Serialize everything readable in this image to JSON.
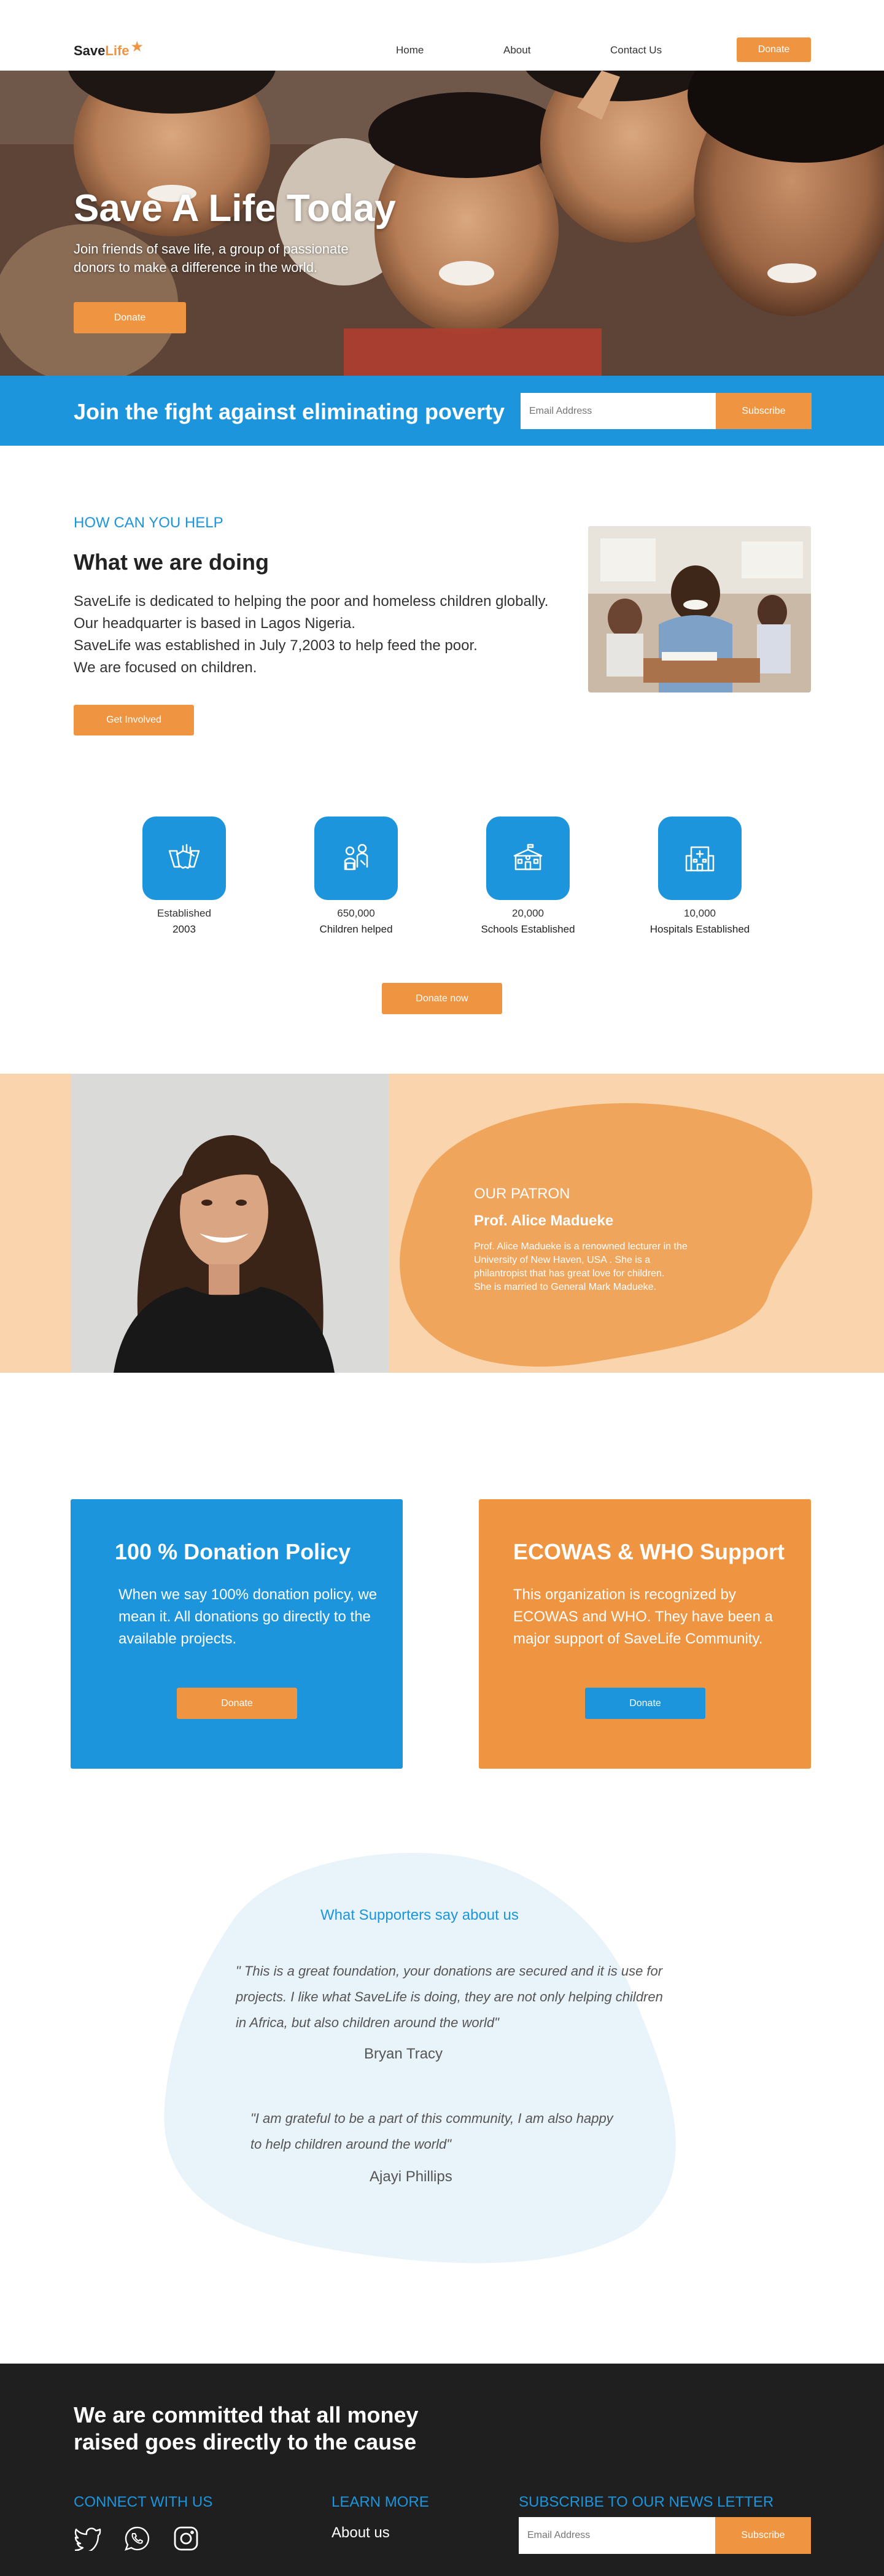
{
  "brand": {
    "name_first": "Save",
    "name_second": "Life"
  },
  "nav": {
    "items": [
      "Home",
      "About",
      "Contact Us"
    ],
    "donate_label": "Donate"
  },
  "hero": {
    "title": "Save A Life Today",
    "subtitle": "Join friends of save life, a group of passionate donors to make a difference in the world.",
    "donate_label": "Donate"
  },
  "subscribe_band": {
    "title": "Join the fight against eliminating poverty",
    "email_placeholder": "Email Address",
    "subscribe_label": "Subscribe"
  },
  "help": {
    "kicker": "HOW CAN YOU HELP",
    "title": "What we are doing",
    "paragraphs": [
      "SaveLife is dedicated to helping the poor and homeless children globally.",
      "Our headquarter is based in Lagos Nigeria.",
      "SaveLife was established in July 7,2003 to help feed the poor.",
      "We are focused on children."
    ],
    "cta_label": "Get Involved"
  },
  "stats": [
    {
      "icon": "handshake-icon",
      "line1": "Established",
      "line2": "2003"
    },
    {
      "icon": "children-icon",
      "line1": "650,000",
      "line2": "Children helped"
    },
    {
      "icon": "school-icon",
      "line1": "20,000",
      "line2": "Schools Established"
    },
    {
      "icon": "hospital-icon",
      "line1": "10,000",
      "line2": "Hospitals Established"
    }
  ],
  "donate_now_label": "Donate now",
  "patron": {
    "kicker": "OUR PATRON",
    "name": "Prof. Alice Madueke",
    "bio": "Prof. Alice Madueke is a renowned lecturer in the University of New Haven, USA . She is a philantropist that has great love for children.",
    "bio2": "She is married to General Mark Madueke."
  },
  "cards": [
    {
      "title": "100 % Donation Policy",
      "body": "When we say 100% donation policy, we mean it. All donations go directly to the available projects.",
      "button": "Donate",
      "color": "#1c95dc"
    },
    {
      "title": "ECOWAS & WHO Support",
      "body": "This organization is recognized by ECOWAS and WHO. They have been a major support of SaveLife Community.",
      "button": "Donate",
      "color": "#ef9440"
    }
  ],
  "testimonials": {
    "title": "What Supporters say about us",
    "items": [
      {
        "quote": "\" This is a great foundation, your donations are secured and it is use for projects. I like what SaveLife is doing, they are not only helping children in Africa, but also children around the world\"",
        "author": "Bryan Tracy"
      },
      {
        "quote": "\"I am grateful to be a part of this community, I am also happy to help children around the world\"",
        "author": "Ajayi Phillips"
      }
    ]
  },
  "footer": {
    "title": "We are committed that all money raised goes directly to the cause",
    "connect_heading": "CONNECT WITH US",
    "learn_heading": "LEARN MORE",
    "about_link": "About us",
    "newsletter_heading": "SUBSCRIBE TO OUR NEWS LETTER",
    "email_placeholder": "Email Address",
    "subscribe_label": "Subscribe",
    "social_icons": [
      "twitter-icon",
      "whatsapp-icon",
      "instagram-icon"
    ]
  },
  "colors": {
    "accent_orange": "#ef9440",
    "accent_blue": "#1c95dc",
    "patron_bg": "#f9d4ad",
    "footer_bg": "#1f1f1f"
  }
}
